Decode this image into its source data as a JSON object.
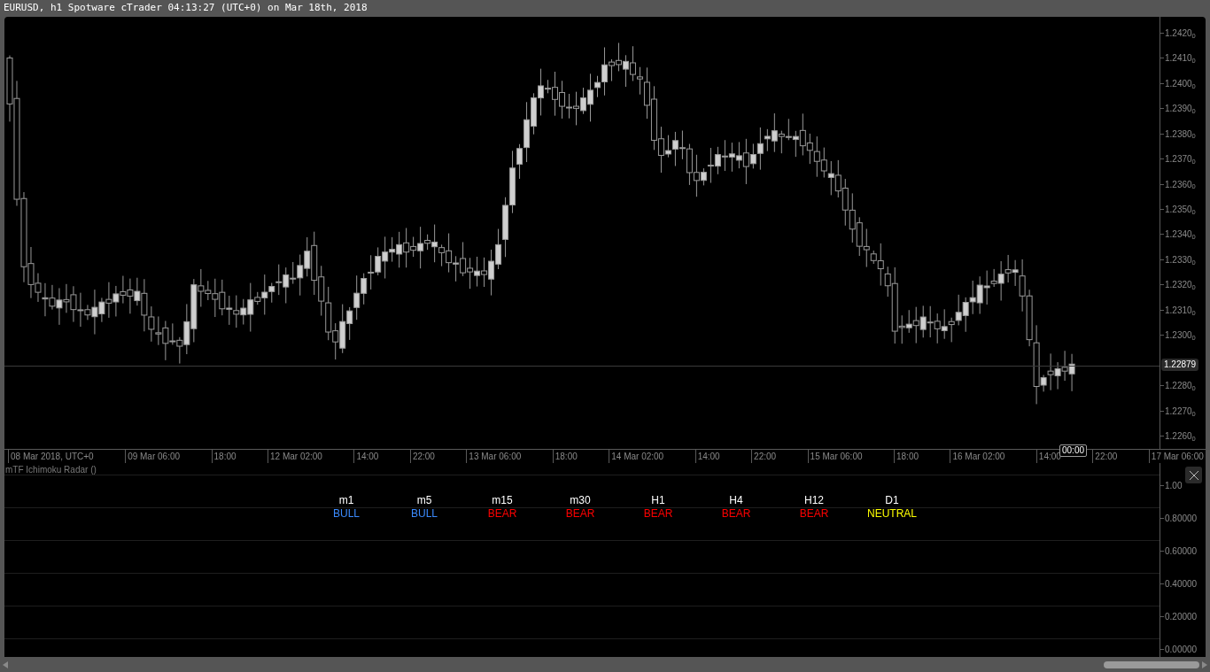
{
  "window": {
    "title": "EURUSD, h1 Spotware cTrader 04:13:27 (UTC+0) on Mar 18th, 2018"
  },
  "price_axis": {
    "ticks": [
      {
        "kind": "tick",
        "text": "1.2420$_{0}$"
      },
      {
        "kind": "tick",
        "text": "1.2410$_{0}$"
      },
      {
        "kind": "tick",
        "text": "1.2400$_{0}$"
      },
      {
        "kind": "tick",
        "text": "1.2390$_{0}$"
      },
      {
        "kind": "tick",
        "text": "1.2380$_{0}$"
      },
      {
        "kind": "tick",
        "text": "1.2370$_{0}$"
      },
      {
        "kind": "tick",
        "text": "1.2360$_{0}$"
      },
      {
        "kind": "tick",
        "text": "1.2350$_{0}$"
      },
      {
        "kind": "tick",
        "text": "1.2340$_{0}$"
      },
      {
        "kind": "tick",
        "text": "1.2330$_{0}$"
      },
      {
        "kind": "tick",
        "text": "1.2320$_{0}$"
      },
      {
        "kind": "tick",
        "text": "1.2310$_{0}$"
      },
      {
        "kind": "tick",
        "text": "1.2300$_{0}$"
      },
      {
        "kind": "current",
        "text": "1.22879"
      },
      {
        "kind": "tick",
        "text": "1.2280$_{0}$"
      },
      {
        "kind": "tick",
        "text": "1.2270$_{0}$"
      },
      {
        "kind": "tick",
        "text": "1.2260$_{0}$"
      }
    ]
  },
  "time_axis": {
    "labels": [
      "08 Mar 2018, UTC+0",
      "09 Mar 06:00",
      "18:00",
      "12 Mar 02:00",
      "14:00",
      "22:00",
      "13 Mar 06:00",
      "18:00",
      "14 Mar 02:00",
      "14:00",
      "22:00",
      "15 Mar 06:00",
      "18:00",
      "16 Mar 02:00",
      "14:00",
      "22:00",
      "17 Mar 06:00"
    ],
    "cursor_time": "00:00"
  },
  "indicator": {
    "title": "mTF Ichimoku Radar ()",
    "axis_ticks": [
      "1.00",
      "0.80000",
      "0.60000",
      "0.40000",
      "0.20000",
      "0.00000"
    ],
    "signals": [
      {
        "timeframe": "m1",
        "status": "BULL",
        "color": "#3b8bff"
      },
      {
        "timeframe": "m5",
        "status": "BULL",
        "color": "#3b8bff"
      },
      {
        "timeframe": "m15",
        "status": "BEAR",
        "color": "#ff0000"
      },
      {
        "timeframe": "m30",
        "status": "BEAR",
        "color": "#ff0000"
      },
      {
        "timeframe": "H1",
        "status": "BEAR",
        "color": "#ff0000"
      },
      {
        "timeframe": "H4",
        "status": "BEAR",
        "color": "#ff0000"
      },
      {
        "timeframe": "H12",
        "status": "BEAR",
        "color": "#ff0000"
      },
      {
        "timeframe": "D1",
        "status": "NEUTRAL",
        "color": "#ffff00"
      }
    ]
  }
}
